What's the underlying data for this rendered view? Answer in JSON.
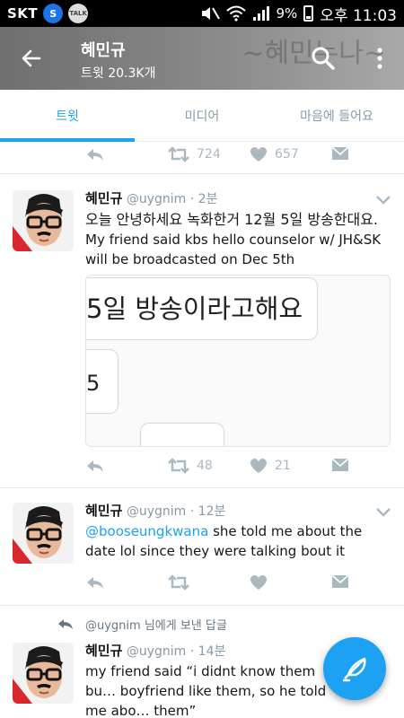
{
  "status_bar": {
    "carrier": "SKT",
    "s_badge": "S",
    "talk_badge": "TALK",
    "battery": "9%",
    "time": "오후 11:03"
  },
  "header": {
    "title": "혜민규",
    "subtitle": "트윗 20.3K개"
  },
  "tabs": [
    {
      "label": "트윗",
      "active": true
    },
    {
      "label": "미디어",
      "active": false
    },
    {
      "label": "마음에 들어요",
      "active": false
    }
  ],
  "prev_tweet_actions": {
    "retweets": "724",
    "likes": "657"
  },
  "tweets": [
    {
      "name": "혜민규",
      "handle": "@uygnim",
      "time": "· 2분",
      "text_ko": "오늘 안녕하세요 녹화한거 12월 5일 방송한대요.",
      "text_en": "My friend said kbs hello counselor w/ JH&SK will be broadcasted on Dec 5th",
      "media_text_1": "5일 방송이라고해요",
      "media_text_2": "5",
      "retweets": "48",
      "likes": "21"
    },
    {
      "name": "혜민규",
      "handle": "@uygnim",
      "time": "· 12분",
      "mention": "@booseungkwana",
      "text": " she told me about the date lol since they were talking bout it",
      "retweets": "",
      "likes": ""
    },
    {
      "reply_context": "@uygnim 님에게 보낸 답글",
      "name": "혜민규",
      "handle": "@uygnim",
      "time": "· 14분",
      "text": "my friend said “i didnt know them bu… boyfriend like them, so he told me abo… them”"
    }
  ],
  "background_text": "~혜민누나~",
  "colors": {
    "accent": "#1da1f2",
    "header_bg": "#7f7f7f",
    "icon_gray": "#aab8c2"
  }
}
